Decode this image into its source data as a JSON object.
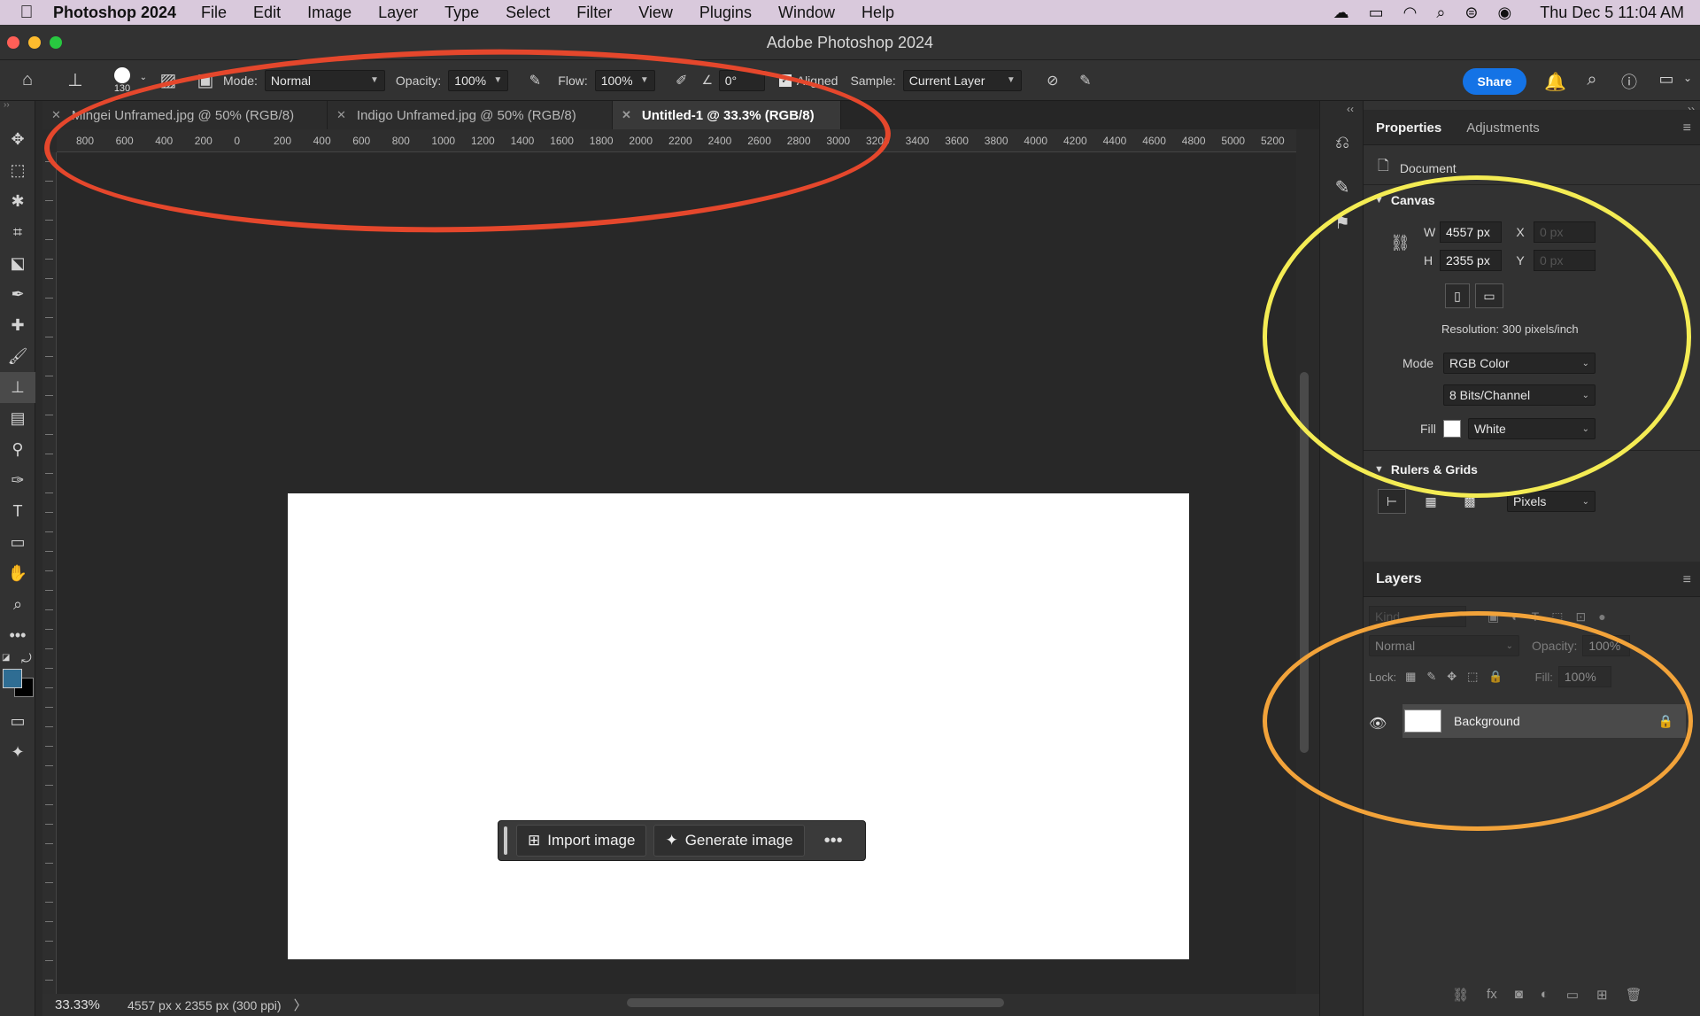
{
  "menubar": {
    "app_name": "Photoshop 2024",
    "items": [
      "File",
      "Edit",
      "Image",
      "Layer",
      "Type",
      "Select",
      "Filter",
      "View",
      "Plugins",
      "Window",
      "Help"
    ],
    "clock": "Thu Dec 5  11:04 AM"
  },
  "window": {
    "title": "Adobe Photoshop 2024"
  },
  "options": {
    "brush_size": "130",
    "mode_label": "Mode:",
    "mode_value": "Normal",
    "opacity_label": "Opacity:",
    "opacity_value": "100%",
    "flow_label": "Flow:",
    "flow_value": "100%",
    "angle_value": "0°",
    "aligned_label": "Aligned",
    "sample_label": "Sample:",
    "sample_value": "Current Layer",
    "share_label": "Share"
  },
  "tabs": [
    {
      "label": "Mingei Unframed.jpg @ 50% (RGB/8)"
    },
    {
      "label": "Indigo Unframed.jpg @ 50% (RGB/8)"
    },
    {
      "label": "Untitled-1 @ 33.3% (RGB/8)"
    }
  ],
  "ruler": [
    "800",
    "600",
    "400",
    "200",
    "0",
    "200",
    "400",
    "600",
    "800",
    "1000",
    "1200",
    "1400",
    "1600",
    "1800",
    "2000",
    "2200",
    "2400",
    "2600",
    "2800",
    "3000",
    "3200",
    "3400",
    "3600",
    "3800",
    "4000",
    "4200",
    "4400",
    "4600",
    "4800",
    "5000",
    "5200"
  ],
  "context_bar": {
    "import_label": "Import image",
    "generate_label": "Generate image",
    "more_label": "•••"
  },
  "status": {
    "zoom": "33.33%",
    "doc_info": "4557 px x 2355 px (300 ppi)",
    "arrow": "〉"
  },
  "properties": {
    "tab_properties": "Properties",
    "tab_adjustments": "Adjustments",
    "document_label": "Document",
    "canvas_title": "Canvas",
    "w_label": "W",
    "w_value": "4557 px",
    "h_label": "H",
    "h_value": "2355 px",
    "x_label": "X",
    "x_value": "0 px",
    "y_label": "Y",
    "y_value": "0 px",
    "resolution": "Resolution: 300 pixels/inch",
    "mode_label": "Mode",
    "mode_value": "RGB Color",
    "depth_value": "8 Bits/Channel",
    "fill_label": "Fill",
    "fill_value": "White",
    "rulers_title": "Rulers & Grids",
    "units_value": "Pixels"
  },
  "layers": {
    "title": "Layers",
    "search_placeholder": "Kind",
    "blend_value": "Normal",
    "opacity_label": "Opacity:",
    "opacity_value": "100%",
    "lock_label": "Lock:",
    "fill_label": "Fill:",
    "fill_value": "100%",
    "layer_name": "Background"
  },
  "colors": {
    "accent": "#1473e6",
    "annotation_red": "#e5472c",
    "annotation_yellow": "#f4ec54",
    "annotation_orange": "#f2a33a",
    "foreground_swatch": "#2f6d93",
    "background_swatch": "#000000"
  }
}
